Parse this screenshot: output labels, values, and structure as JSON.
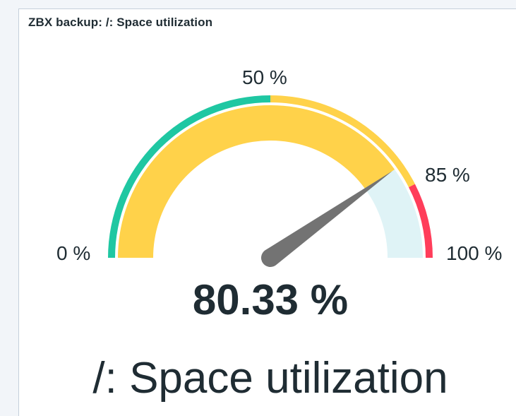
{
  "widget": {
    "header": "ZBX backup: /: Space utilization",
    "value_text": "80.33 %",
    "description": "/: Space utilization"
  },
  "gauge": {
    "value": 80.33,
    "min": 0,
    "max": 100,
    "scale_labels": {
      "min": "0 %",
      "mid": "50 %",
      "warn": "85 %",
      "max": "100 %"
    },
    "thresholds": [
      {
        "from": 0,
        "to": 50,
        "color": "#1fc7a2"
      },
      {
        "from": 50,
        "to": 85,
        "color": "#ffd24a"
      },
      {
        "from": 85,
        "to": 100,
        "color": "#ff3d5a"
      }
    ],
    "value_color": "#ffd24a",
    "empty_color": "#dff3f6",
    "needle_color": "#737373"
  }
}
